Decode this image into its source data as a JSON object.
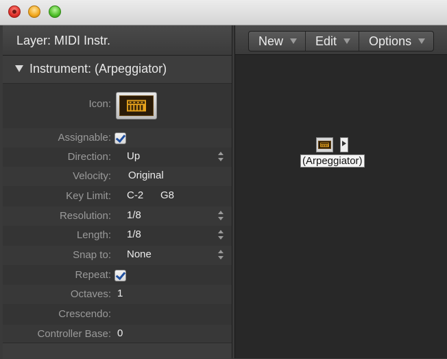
{
  "window": {
    "controls": [
      "close",
      "minimize",
      "zoom"
    ]
  },
  "inspector": {
    "layer_label": "Layer:  MIDI Instr.",
    "instrument_title": "Instrument: (Arpeggiator)",
    "icon_label": "Icon:",
    "fields": {
      "assignable": {
        "label": "Assignable:",
        "checked": true
      },
      "direction": {
        "label": "Direction:",
        "value": "Up"
      },
      "velocity": {
        "label": "Velocity:",
        "value": "Original"
      },
      "key_limit": {
        "label": "Key Limit:",
        "low": "C-2",
        "high": "G8"
      },
      "resolution": {
        "label": "Resolution:",
        "value": "1/8"
      },
      "length": {
        "label": "Length:",
        "value": "1/8"
      },
      "snap_to": {
        "label": "Snap to:",
        "value": "None"
      },
      "repeat": {
        "label": "Repeat:",
        "checked": true
      },
      "octaves": {
        "label": "Octaves:",
        "value": "1"
      },
      "crescendo": {
        "label": "Crescendo:",
        "value": ""
      },
      "controller_base": {
        "label": "Controller Base:",
        "value": "0"
      }
    }
  },
  "environment": {
    "menus": [
      "New",
      "Edit",
      "Options"
    ],
    "node": {
      "name": "(Arpeggiator)"
    }
  },
  "colors": {
    "panel_bg": "#343434",
    "env_bg": "#282828",
    "label": "#9a9a9a",
    "value": "#ececec",
    "check_blue": "#1f4f9f"
  }
}
